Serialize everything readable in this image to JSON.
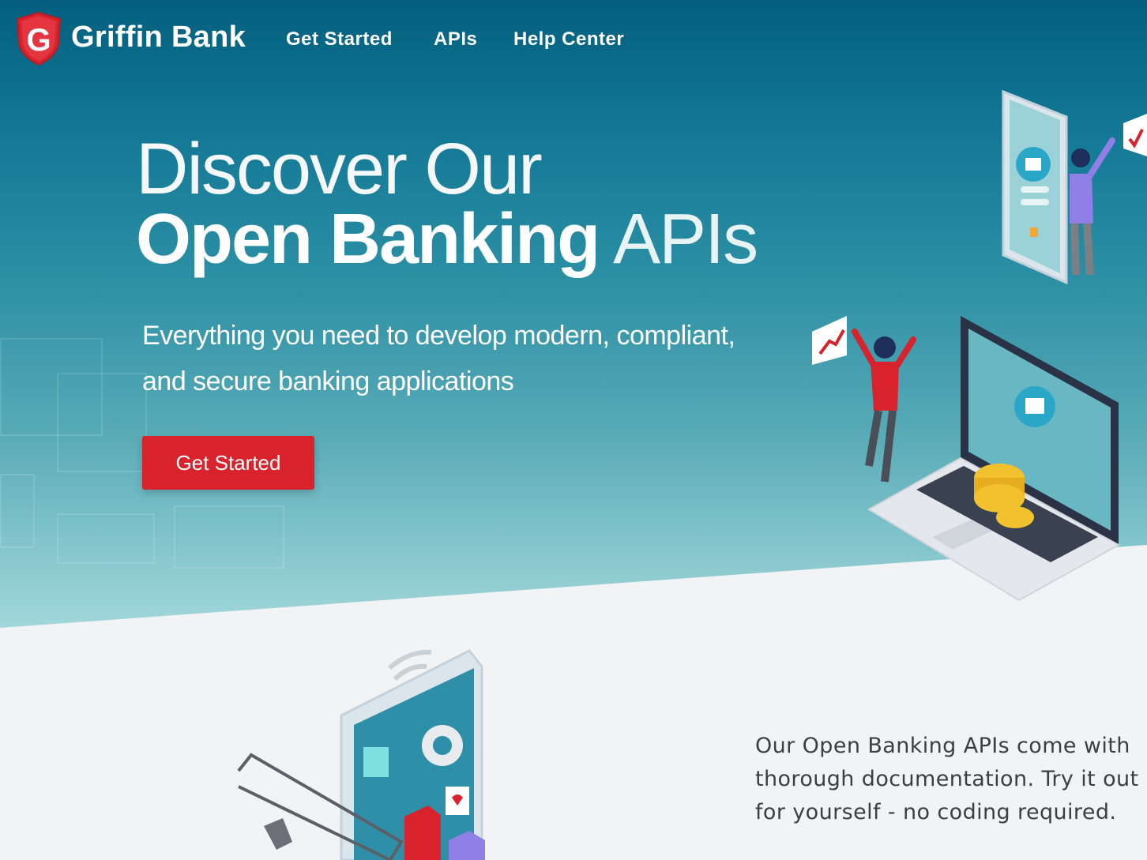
{
  "brand": {
    "name": "Griffin Bank",
    "logo_letter": "G",
    "color": "#d8232d"
  },
  "nav": {
    "items": [
      "Get Started",
      "APIs",
      "Help Center"
    ]
  },
  "hero": {
    "title_line1": "Discover Our",
    "title_line2_bold": "Open Banking",
    "title_line2_light": "APIs",
    "subtitle_line1": "Everything you need to develop modern, compliant,",
    "subtitle_line2": "and secure banking applications",
    "cta_label": "Get Started"
  },
  "features": {
    "description_line1": "Our Open Banking APIs come with",
    "description_line2": "thorough documentation. Try it out",
    "description_line3": "for yourself - no coding required."
  },
  "colors": {
    "hero_top": "#045f7e",
    "hero_bottom": "#b0e0e3",
    "accent": "#d8232d",
    "page_bg": "#f2f3f4"
  }
}
